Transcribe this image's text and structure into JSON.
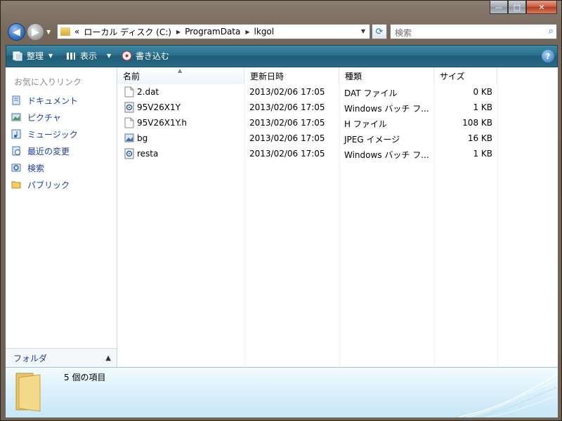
{
  "window": {
    "controls": {
      "minimize": "—",
      "maximize": "□",
      "close": "✕"
    }
  },
  "address": {
    "prefix": "«",
    "crumbs": [
      "ローカル ディスク (C:)",
      "ProgramData",
      "lkgol"
    ],
    "search_placeholder": "検索"
  },
  "toolbar": {
    "organize_label": "整理",
    "views_label": "表示",
    "burn_label": "書き込む",
    "help_label": "?"
  },
  "sidebar": {
    "header": "お気に入りリンク",
    "items": [
      {
        "label": "ドキュメント",
        "icon": "documents-icon"
      },
      {
        "label": "ピクチャ",
        "icon": "pictures-icon"
      },
      {
        "label": "ミュージック",
        "icon": "music-icon"
      },
      {
        "label": "最近の変更",
        "icon": "recent-changes-icon"
      },
      {
        "label": "検索",
        "icon": "search-folder-icon"
      },
      {
        "label": "パブリック",
        "icon": "public-folder-icon"
      }
    ],
    "folders_label": "フォルダ"
  },
  "columns": {
    "name": "名前",
    "modified": "更新日時",
    "type": "種類",
    "size": "サイズ"
  },
  "files": [
    {
      "name": "2.dat",
      "modified": "2013/02/06 17:05",
      "type": "DAT ファイル",
      "size": "0 KB",
      "icon": "file-icon"
    },
    {
      "name": "95V26X1Y",
      "modified": "2013/02/06 17:05",
      "type": "Windows バッチ フ...",
      "size": "1 KB",
      "icon": "batch-file-icon"
    },
    {
      "name": "95V26X1Y.h",
      "modified": "2013/02/06 17:05",
      "type": "H ファイル",
      "size": "108 KB",
      "icon": "file-icon"
    },
    {
      "name": "bg",
      "modified": "2013/02/06 17:05",
      "type": "JPEG イメージ",
      "size": "16 KB",
      "icon": "image-file-icon"
    },
    {
      "name": "resta",
      "modified": "2013/02/06 17:05",
      "type": "Windows バッチ フ...",
      "size": "1 KB",
      "icon": "batch-file-icon"
    }
  ],
  "status": {
    "item_count": "5 個の項目"
  }
}
